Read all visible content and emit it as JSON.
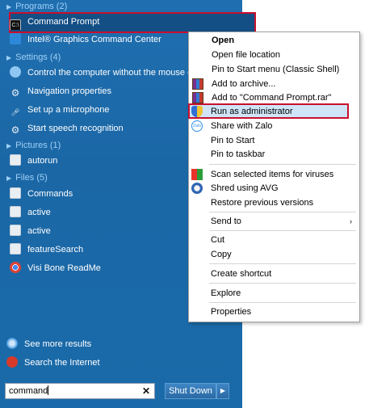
{
  "start_menu": {
    "programs_header": "Programs (2)",
    "programs": [
      {
        "label": "Command Prompt",
        "icon": "cmd-icon"
      },
      {
        "label": "Intel® Graphics Command Center",
        "icon": "intel-icon"
      }
    ],
    "settings_header": "Settings (4)",
    "settings": [
      {
        "label": "Control the computer without the mouse or k",
        "icon": "control-panel-icon"
      },
      {
        "label": "Navigation properties",
        "icon": "gear-icon"
      },
      {
        "label": "Set up a microphone",
        "icon": "microphone-icon"
      },
      {
        "label": "Start speech recognition",
        "icon": "gear-icon"
      }
    ],
    "pictures_header": "Pictures (1)",
    "pictures": [
      {
        "label": "autorun",
        "icon": "file-icon"
      }
    ],
    "files_header": "Files (5)",
    "files": [
      {
        "label": "Commands",
        "icon": "file-icon"
      },
      {
        "label": "active",
        "icon": "file-icon"
      },
      {
        "label": "active",
        "icon": "file-icon"
      },
      {
        "label": "featureSearch",
        "icon": "file-icon"
      },
      {
        "label": "Visi Bone ReadMe",
        "icon": "chrome-icon"
      }
    ],
    "see_more": "See more results",
    "search_internet": "Search the Internet",
    "search_value": "command",
    "search_clear": "✕",
    "shutdown_label": "Shut Down",
    "shutdown_arrow": "▶"
  },
  "context_menu": {
    "items": [
      {
        "label": "Open",
        "bold": true
      },
      {
        "label": "Open file location"
      },
      {
        "label": "Pin to Start menu (Classic Shell)"
      },
      {
        "label": "Add to archive...",
        "icon": "winrar-icon"
      },
      {
        "label": "Add to \"Command Prompt.rar\"",
        "icon": "winrar-icon"
      },
      {
        "label": "Run as administrator",
        "icon": "uac-shield-icon",
        "highlighted": true
      },
      {
        "label": "Share with Zalo",
        "icon": "zalo-icon"
      },
      {
        "label": "Pin to Start"
      },
      {
        "label": "Pin to taskbar"
      },
      {
        "label": "Scan selected items for viruses",
        "icon": "malwarebytes-icon"
      },
      {
        "label": "Shred using AVG",
        "icon": "avg-icon"
      },
      {
        "label": "Restore previous versions"
      },
      {
        "label": "Send to",
        "submenu": true
      },
      {
        "label": "Cut"
      },
      {
        "label": "Copy"
      },
      {
        "label": "Create shortcut"
      },
      {
        "label": "Explore"
      },
      {
        "label": "Properties"
      }
    ],
    "submenu_arrow": "›"
  },
  "colors": {
    "menu_bg": "#1b67a6",
    "section_header": "#9fd0f6",
    "highlight_border": "#c8102e",
    "context_hover": "#cfe5f7"
  }
}
